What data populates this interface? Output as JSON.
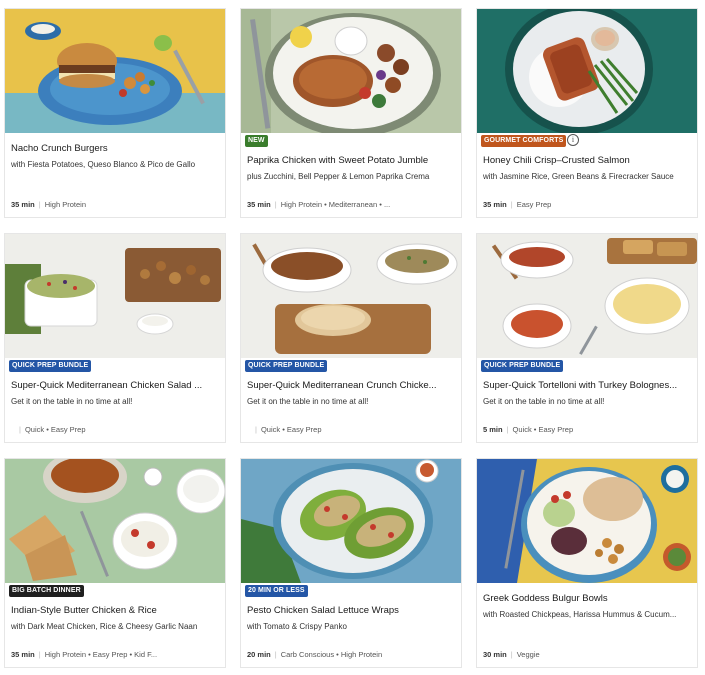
{
  "colors": {
    "green_badge": "#3a7d2c",
    "blue_badge": "#2456a6",
    "orange_badge": "#c0561d",
    "dark_badge": "#1f1f1f"
  },
  "cards": [
    {
      "title": "Nacho Crunch Burgers",
      "subtitle": "with Fiesta Potatoes, Queso Blanco & Pico de Gallo",
      "time": "35 min",
      "tags": "High Protein",
      "badge": ""
    },
    {
      "title": "Paprika Chicken with Sweet Potato Jumble",
      "subtitle": "plus Zucchini, Bell Pepper & Lemon Paprika Crema",
      "time": "35 min",
      "tags": "High Protein • Mediterranean • ...",
      "badge": "NEW"
    },
    {
      "title": "Honey Chili Crisp–Crusted Salmon",
      "subtitle": "with Jasmine Rice, Green Beans & Firecracker Sauce",
      "time": "35 min",
      "tags": "Easy Prep",
      "badge": "GOURMET COMFORTS",
      "info": "i"
    },
    {
      "title": "Super-Quick Mediterranean Chicken Salad ...",
      "subtitle": "Get it on the table in no time at all!",
      "time": "",
      "tags": "Quick • Easy Prep",
      "badge": "QUICK PREP BUNDLE"
    },
    {
      "title": "Super-Quick Mediterranean Crunch Chicke...",
      "subtitle": "Get it on the table in no time at all!",
      "time": "",
      "tags": "Quick • Easy Prep",
      "badge": "QUICK PREP BUNDLE"
    },
    {
      "title": "Super-Quick Tortelloni with Turkey Bolognes...",
      "subtitle": "Get it on the table in no time at all!",
      "time": "5 min",
      "tags": "Quick • Easy Prep",
      "badge": "QUICK PREP BUNDLE"
    },
    {
      "title": "Indian-Style Butter Chicken & Rice",
      "subtitle": "with Dark Meat Chicken, Rice & Cheesy Garlic Naan",
      "time": "35 min",
      "tags": "High Protein • Easy Prep • Kid F...",
      "badge": "BIG BATCH DINNER"
    },
    {
      "title": "Pesto Chicken Salad Lettuce Wraps",
      "subtitle": "with Tomato & Crispy Panko",
      "time": "20 min",
      "tags": "Carb Conscious • High Protein",
      "badge": "20 MIN OR LESS"
    },
    {
      "title": "Greek Goddess Bulgur Bowls",
      "subtitle": "with Roasted Chickpeas, Harissa Hummus & Cucum...",
      "time": "30 min",
      "tags": "Veggie",
      "badge": ""
    }
  ]
}
